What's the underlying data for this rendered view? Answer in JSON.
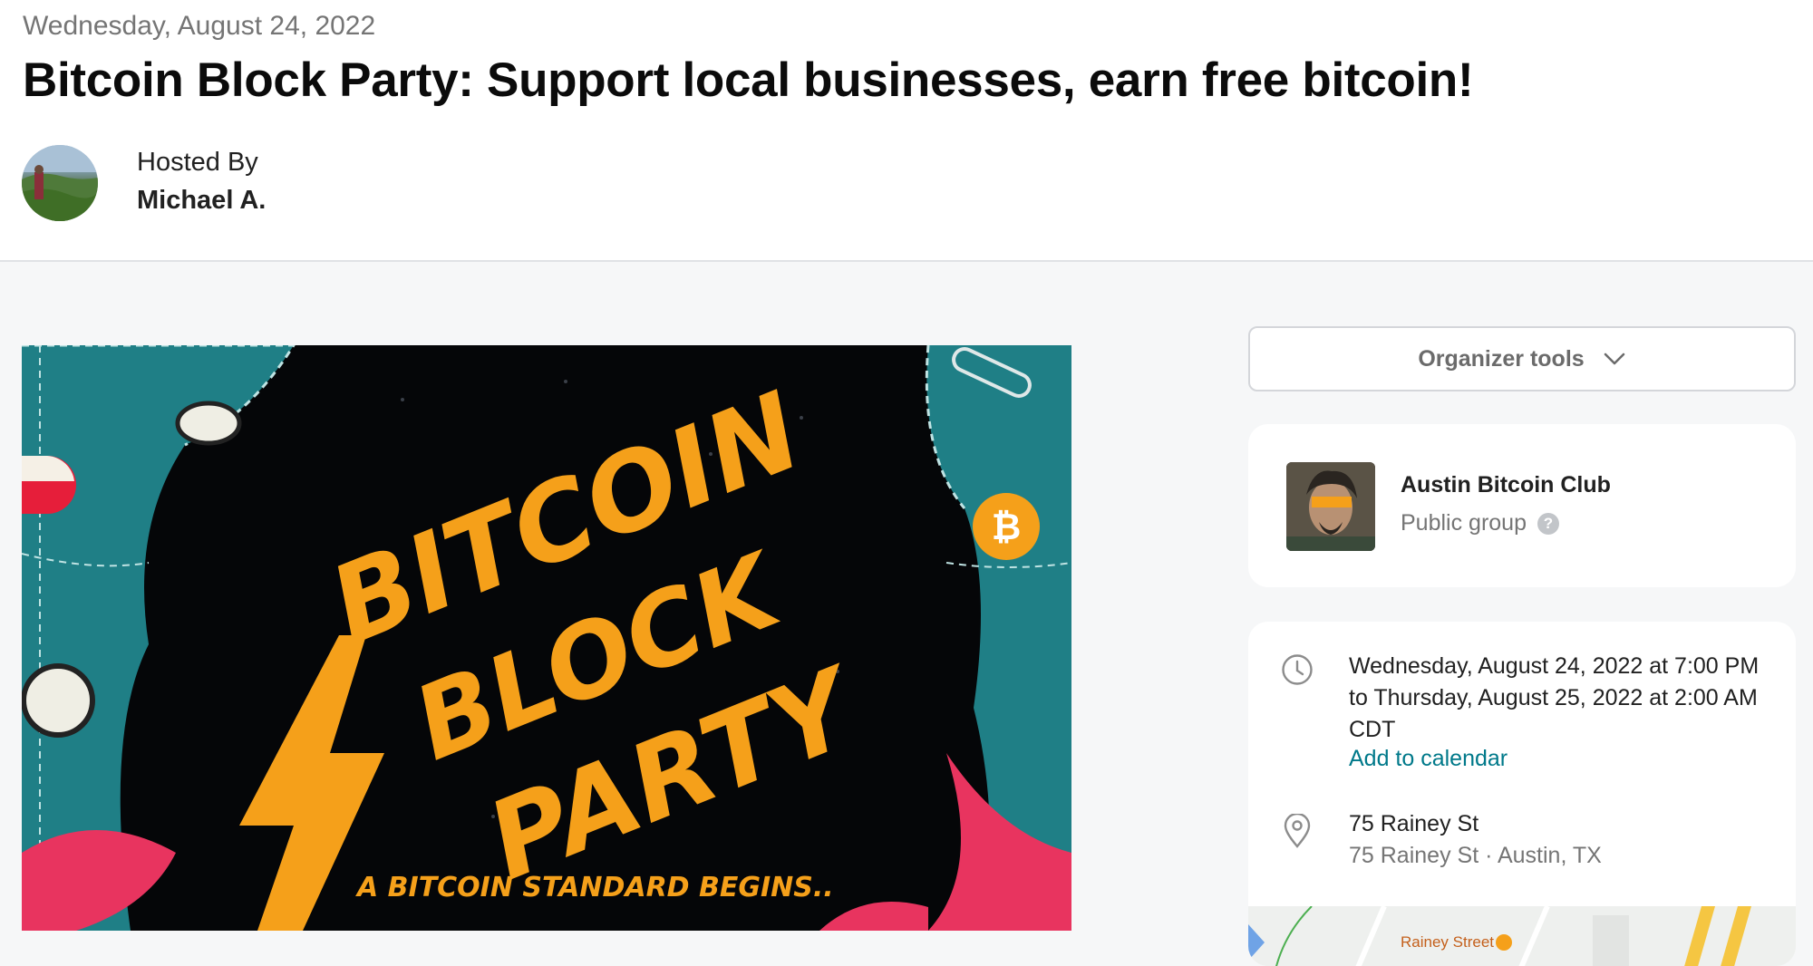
{
  "event": {
    "date": "Wednesday, August 24, 2022",
    "title": "Bitcoin Block Party: Support local businesses, earn free bitcoin!",
    "hosted_by_label": "Hosted By",
    "host_name": "Michael A."
  },
  "hero_image": {
    "line1": "BITCOIN",
    "line2": "BLOCK",
    "line3": "PARTY",
    "tagline": "A BITCOIN STANDARD BEGINS..",
    "coin_symbol": "₿"
  },
  "organizer_tools": {
    "label": "Organizer tools",
    "icon": "chevron-down-icon"
  },
  "group": {
    "name": "Austin Bitcoin Club",
    "type": "Public group",
    "help_glyph": "?"
  },
  "details": {
    "datetime": "Wednesday, August 24, 2022 at 7:00 PM to Thursday, August 25, 2022 at 2:00 AM CDT",
    "add_to_calendar": "Add to calendar",
    "venue_name": "75 Rainey St",
    "venue_address": "75 Rainey St · Austin, TX",
    "map_street_label": "Rainey Street"
  },
  "colors": {
    "link": "#00798a",
    "hero_orange": "#f5a01a",
    "hero_teal": "#1f7f86",
    "hero_pink": "#e8345f"
  }
}
